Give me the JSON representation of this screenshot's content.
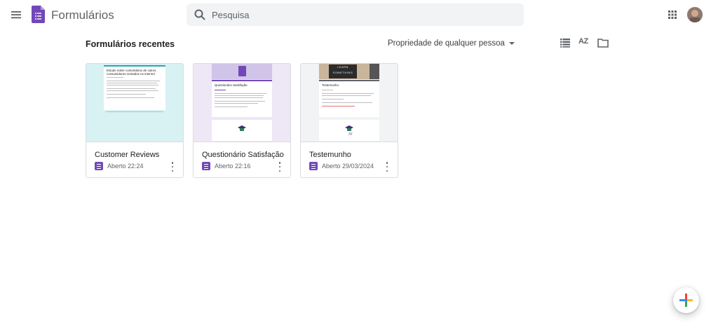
{
  "app": {
    "title": "Formulários"
  },
  "search": {
    "placeholder": "Pesquisa"
  },
  "main": {
    "section_title": "Formulários recentes",
    "owner_filter": "Propriedade de qualquer pessoa",
    "sort_label": "AZ"
  },
  "cards": [
    {
      "title": "Customer Reviews",
      "meta": "Aberto 22:24",
      "thumb_title": "Estudo sobre comentários de outros consumidores restrados no internet"
    },
    {
      "title": "Questionário Satisfação",
      "meta": "Aberto 22:16",
      "thumb_title": "Questionário Satisfação"
    },
    {
      "title": "Testemunho",
      "meta": "Aberto 29/03/2024",
      "thumb_title": "Testemunho",
      "thumb_banner": "LEARN SOMETHING",
      "thumb_logo": "πi"
    }
  ],
  "colors": {
    "forms_purple": "#7248b9",
    "teal": "#25a7b5"
  },
  "icons": [
    "hamburger-menu-icon",
    "forms-logo-icon",
    "search-icon",
    "apps-grid-icon",
    "list-view-icon",
    "sort-az-icon",
    "folder-icon",
    "more-vert-icon",
    "add-icon"
  ]
}
